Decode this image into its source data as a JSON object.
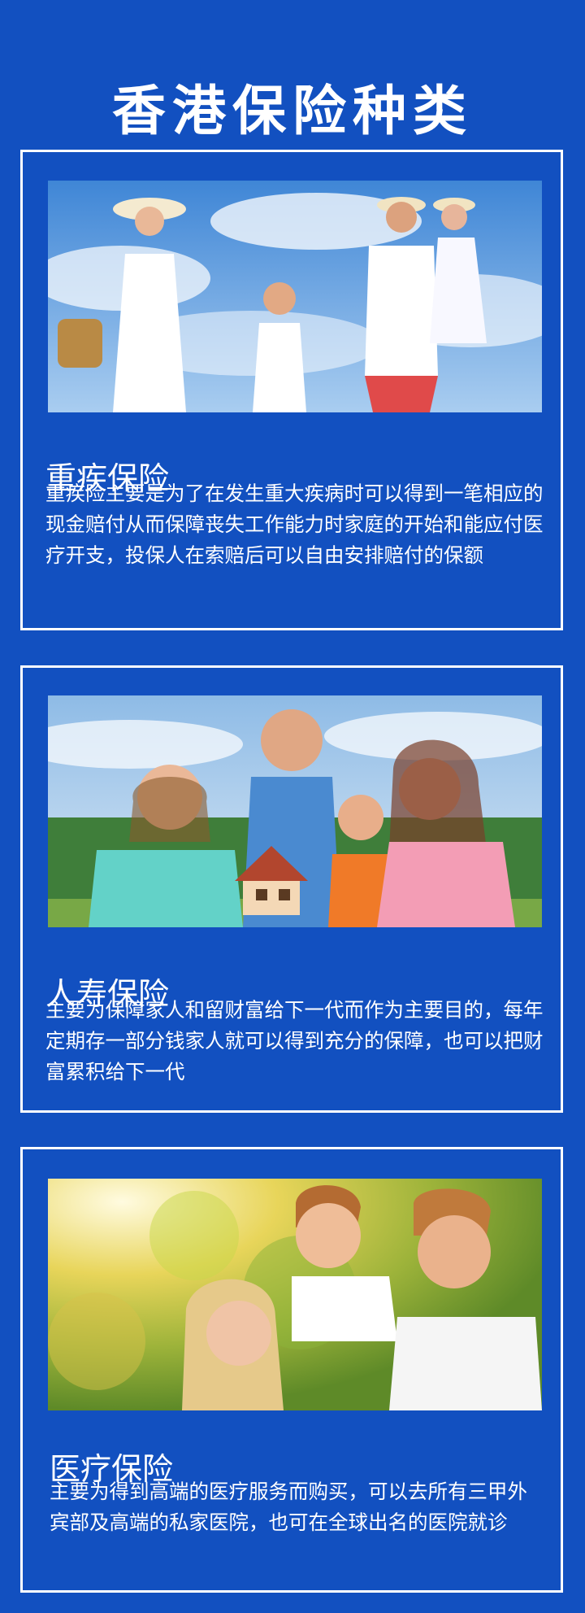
{
  "page": {
    "title": "香港保险种类"
  },
  "sections": [
    {
      "title": "重疾保险",
      "body": "重疾险主要是为了在发生重大疾病时可以得到一笔相应的现金赔付从而保障丧失工作能力时家庭的开始和能应付医疗开支，投保人在索赔后可以自由安排赔付的保额",
      "image": "family-beach-photo"
    },
    {
      "title": "人寿保险",
      "body": "主要为保障家人和留财富给下一代而作为主要目的，每年定期存一部分钱家人就可以得到充分的保障，也可以把财富累积给下一代",
      "image": "family-house-model-photo"
    },
    {
      "title": "医疗保险",
      "body": "主要为得到高端的医疗服务而购买，可以去所有三甲外宾部及高端的私家医院，也可在全球出名的医院就诊",
      "image": "family-outdoor-photo"
    }
  ],
  "colors": {
    "background": "#1250c0",
    "text": "#ffffff",
    "border": "#ffffff"
  }
}
